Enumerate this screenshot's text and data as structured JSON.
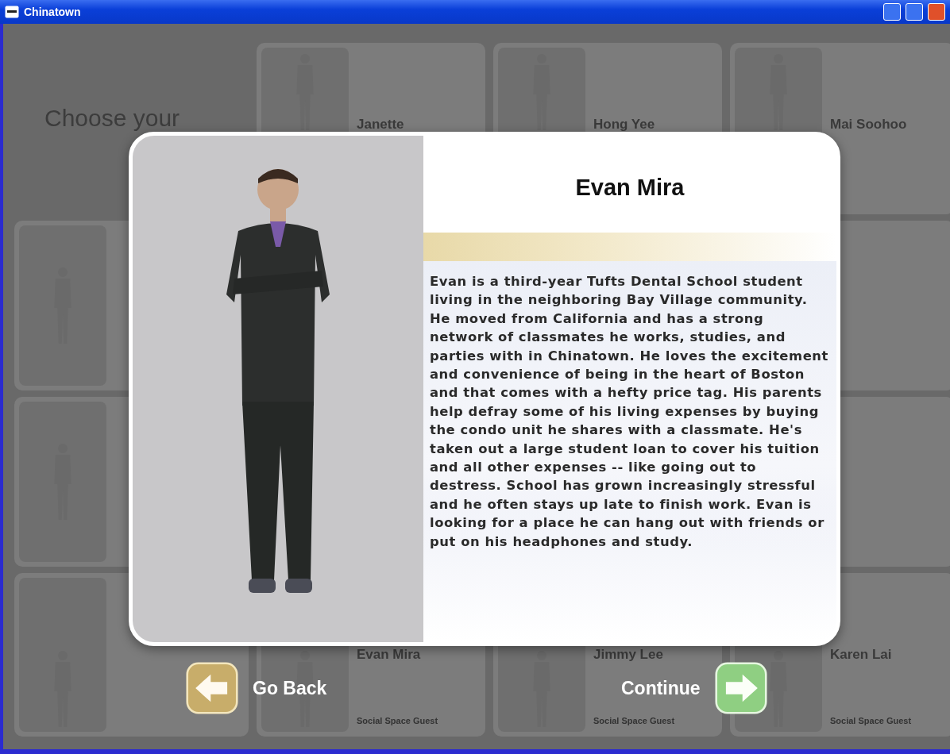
{
  "window": {
    "title": "Chinatown"
  },
  "background": {
    "heading": "Choose your",
    "tiles": [
      {
        "kind": "heading"
      },
      {
        "kind": "tile",
        "name": "Janette"
      },
      {
        "kind": "tile",
        "name": "Hong Yee"
      },
      {
        "kind": "tile",
        "name": "Mai Soohoo"
      },
      {
        "kind": "tile"
      },
      {
        "kind": "blank"
      },
      {
        "kind": "blank"
      },
      {
        "kind": "partial"
      },
      {
        "kind": "tile"
      },
      {
        "kind": "blank"
      },
      {
        "kind": "blank"
      },
      {
        "kind": "partial"
      },
      {
        "kind": "tile"
      },
      {
        "kind": "tile",
        "name": "Evan Mira",
        "subtitle": "Social Space Guest"
      },
      {
        "kind": "tile",
        "name": "Jimmy Lee",
        "subtitle": "Social Space Guest"
      },
      {
        "kind": "tile",
        "name": "Karen Lai",
        "subtitle": "Social Space Guest"
      }
    ]
  },
  "profile": {
    "name": "Evan Mira",
    "description": "Evan is a third-year Tufts Dental School student living in the neighboring Bay Village community. He moved from California and has a strong network of classmates he works, studies, and parties with in Chinatown. He loves the excitement and convenience of being in the heart of Boston and that comes with a hefty price tag. His parents help defray some of his living expenses by buying the condo unit he shares with a classmate. He's taken out a large student loan to cover his tuition and all other expenses -- like going out to destress. School has grown increasingly stressful and he often stays up late to finish work. Evan is looking for a place he can hang out with friends or put on his headphones and study."
  },
  "actions": [
    {
      "kind": "back",
      "label": "Go Back"
    },
    {
      "kind": "continue",
      "label": "Continue"
    }
  ]
}
